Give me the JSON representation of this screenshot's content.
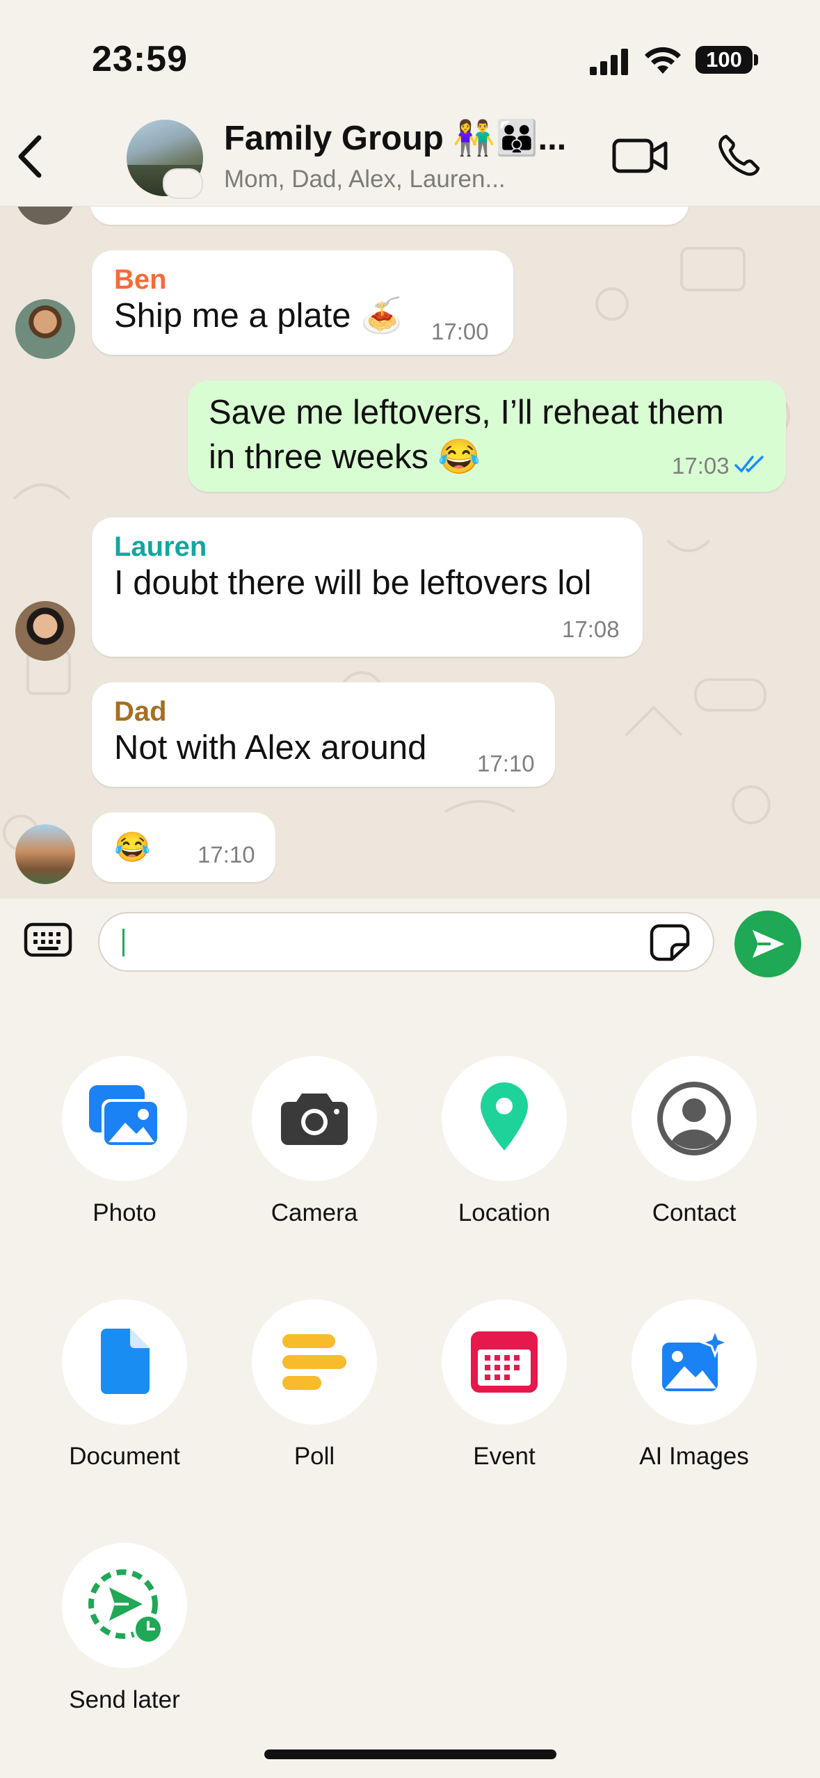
{
  "status_bar": {
    "time": "23:59",
    "battery": "100"
  },
  "header": {
    "title": "Family Group 👫👪...",
    "subtitle": "Mom, Dad, Alex, Lauren..."
  },
  "messages": [
    {
      "sender": "Ben",
      "sender_color": "#f56b3a",
      "text": "Ship me a plate 🍝",
      "time": "17:00"
    },
    {
      "sender": "",
      "text_line1": "Save me leftovers, I’ll reheat them",
      "text_line2": "in three weeks 😂",
      "time": "17:03",
      "outgoing": true
    },
    {
      "sender": "Lauren",
      "sender_color": "#13a6a0",
      "text": "I doubt there will be leftovers lol",
      "time": "17:08"
    },
    {
      "sender": "Dad",
      "sender_color": "#a66f23",
      "text": "Not with Alex around",
      "time": "17:10"
    },
    {
      "sender": "",
      "text": "😂",
      "time": "17:10"
    }
  ],
  "colors": {
    "accent": "#1fa855",
    "chat_bg": "#ede6dc",
    "outgoing_bubble": "#d9fdd3",
    "read_ticks": "#1a8cff"
  },
  "attachments": [
    {
      "label": "Photo",
      "icon": "photo-icon"
    },
    {
      "label": "Camera",
      "icon": "camera-icon"
    },
    {
      "label": "Location",
      "icon": "location-icon"
    },
    {
      "label": "Contact",
      "icon": "contact-icon"
    },
    {
      "label": "Document",
      "icon": "document-icon"
    },
    {
      "label": "Poll",
      "icon": "poll-icon"
    },
    {
      "label": "Event",
      "icon": "event-icon"
    },
    {
      "label": "AI Images",
      "icon": "ai-images-icon"
    },
    {
      "label": "Send later",
      "icon": "send-later-icon"
    }
  ]
}
